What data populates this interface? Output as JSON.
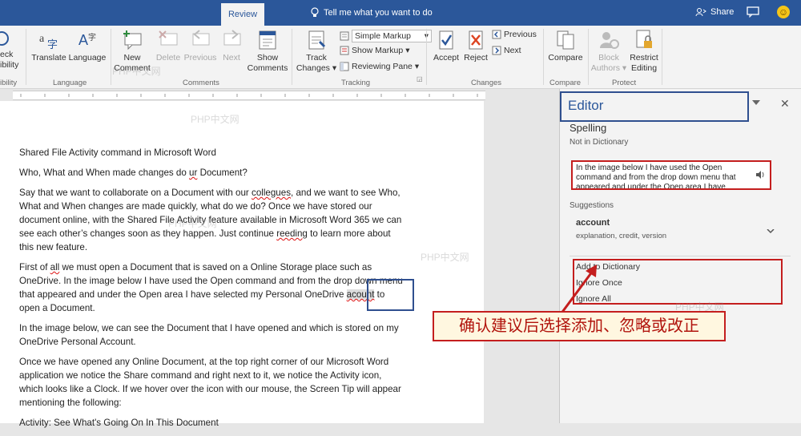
{
  "topbar": {
    "active_tab": "Review",
    "tell_me": "Tell me what you want to do",
    "share": "Share"
  },
  "ribbon": {
    "check_accessibility": [
      "eck",
      "ibility"
    ],
    "translate": "Translate",
    "language": "Language",
    "group_language": "Language",
    "group_accessibility": "ibility",
    "new_comment": [
      "New",
      "Comment"
    ],
    "delete": "Delete",
    "previous": "Previous",
    "next": "Next",
    "show_comments": [
      "Show",
      "Comments"
    ],
    "group_comments": "Comments",
    "track_changes": [
      "Track",
      "Changes"
    ],
    "simple_markup": "Simple Markup",
    "show_markup": "Show Markup",
    "reviewing_pane": "Reviewing Pane",
    "group_tracking": "Tracking",
    "accept": "Accept",
    "reject": "Reject",
    "prev_change": "Previous",
    "next_change": "Next",
    "group_changes": "Changes",
    "compare": "Compare",
    "group_compare": "Compare",
    "block_authors": [
      "Block",
      "Authors"
    ],
    "restrict_editing": [
      "Restrict",
      "Editing"
    ],
    "group_protect": "Protect"
  },
  "document": {
    "p1": "Shared File Activity command in Microsoft Word",
    "p2_pre": "Who, What and When made changes do ",
    "p2_err": "ur",
    "p2_post": " Document?",
    "p3_a": "Say that we want to collaborate on a Document with our ",
    "p3_err1": "collegues",
    "p3_b": ", and we want to see Who, What and When changes are made quickly, what do we do?  Once we have stored our document online, with the Shared File Activity feature available in Microsoft Word 365 we can see each other’s changes soon as they happen.  Just continue ",
    "p3_err2": "reeding",
    "p3_c": " to learn more about this new feature.",
    "p4_a": "First of ",
    "p4_all": "all",
    "p4_b": " we must open a Document that is saved on a Online Storage place such as OneDrive.  In the image below I have used the Open command and from the drop down menu that appeared and under the Open area I have selected my Personal OneDrive ",
    "p4_err": "acount",
    "p4_c": " to open a Document.",
    "p5": " In the image below, we can see the Document that I have opened and which is stored on my OneDrive Personal Account.",
    "p6": " Once we have opened any Online Document, at the top right corner of our Microsoft Word application we notice the Share command and right next to it, we notice the Activity icon, which looks like a Clock.  If we hover over the icon with our mouse, the Screen Tip will appear mentioning the following:",
    "p7": "Activity: See What's Going On In This Document"
  },
  "editor": {
    "title": "Editor",
    "spelling": "Spelling",
    "not_in_dictionary": "Not in Dictionary",
    "context": "In the image below I have used the Open command and from the drop down menu that appeared and under the Open area I have",
    "suggestions_label": "Suggestions",
    "suggestion": "account",
    "synonyms": "explanation, credit, version",
    "add_to_dictionary": "Add to Dictionary",
    "ignore_once": "Ignore Once",
    "ignore_all": "Ignore All"
  },
  "annotation": {
    "callout": "确认建议后选择添加、忽略或改正"
  },
  "watermarks": [
    "PHP中文网",
    "PHP中文网",
    "PHP中文网",
    "PHP中文网",
    "PHP中文网"
  ],
  "colors": {
    "word_blue": "#2b579a",
    "annotation_red": "#c41e1e"
  }
}
